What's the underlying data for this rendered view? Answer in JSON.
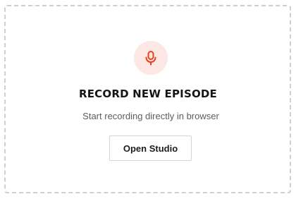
{
  "card": {
    "icon": "microphone-icon",
    "title": "RECORD NEW EPISODE",
    "subtitle": "Start recording directly in browser",
    "button_label": "Open Studio"
  },
  "colors": {
    "accent": "#e8401c",
    "icon_badge_bg": "#fde7e4",
    "border": "#cfcfcf",
    "title": "#151515",
    "subtitle": "#5c5c5c"
  }
}
